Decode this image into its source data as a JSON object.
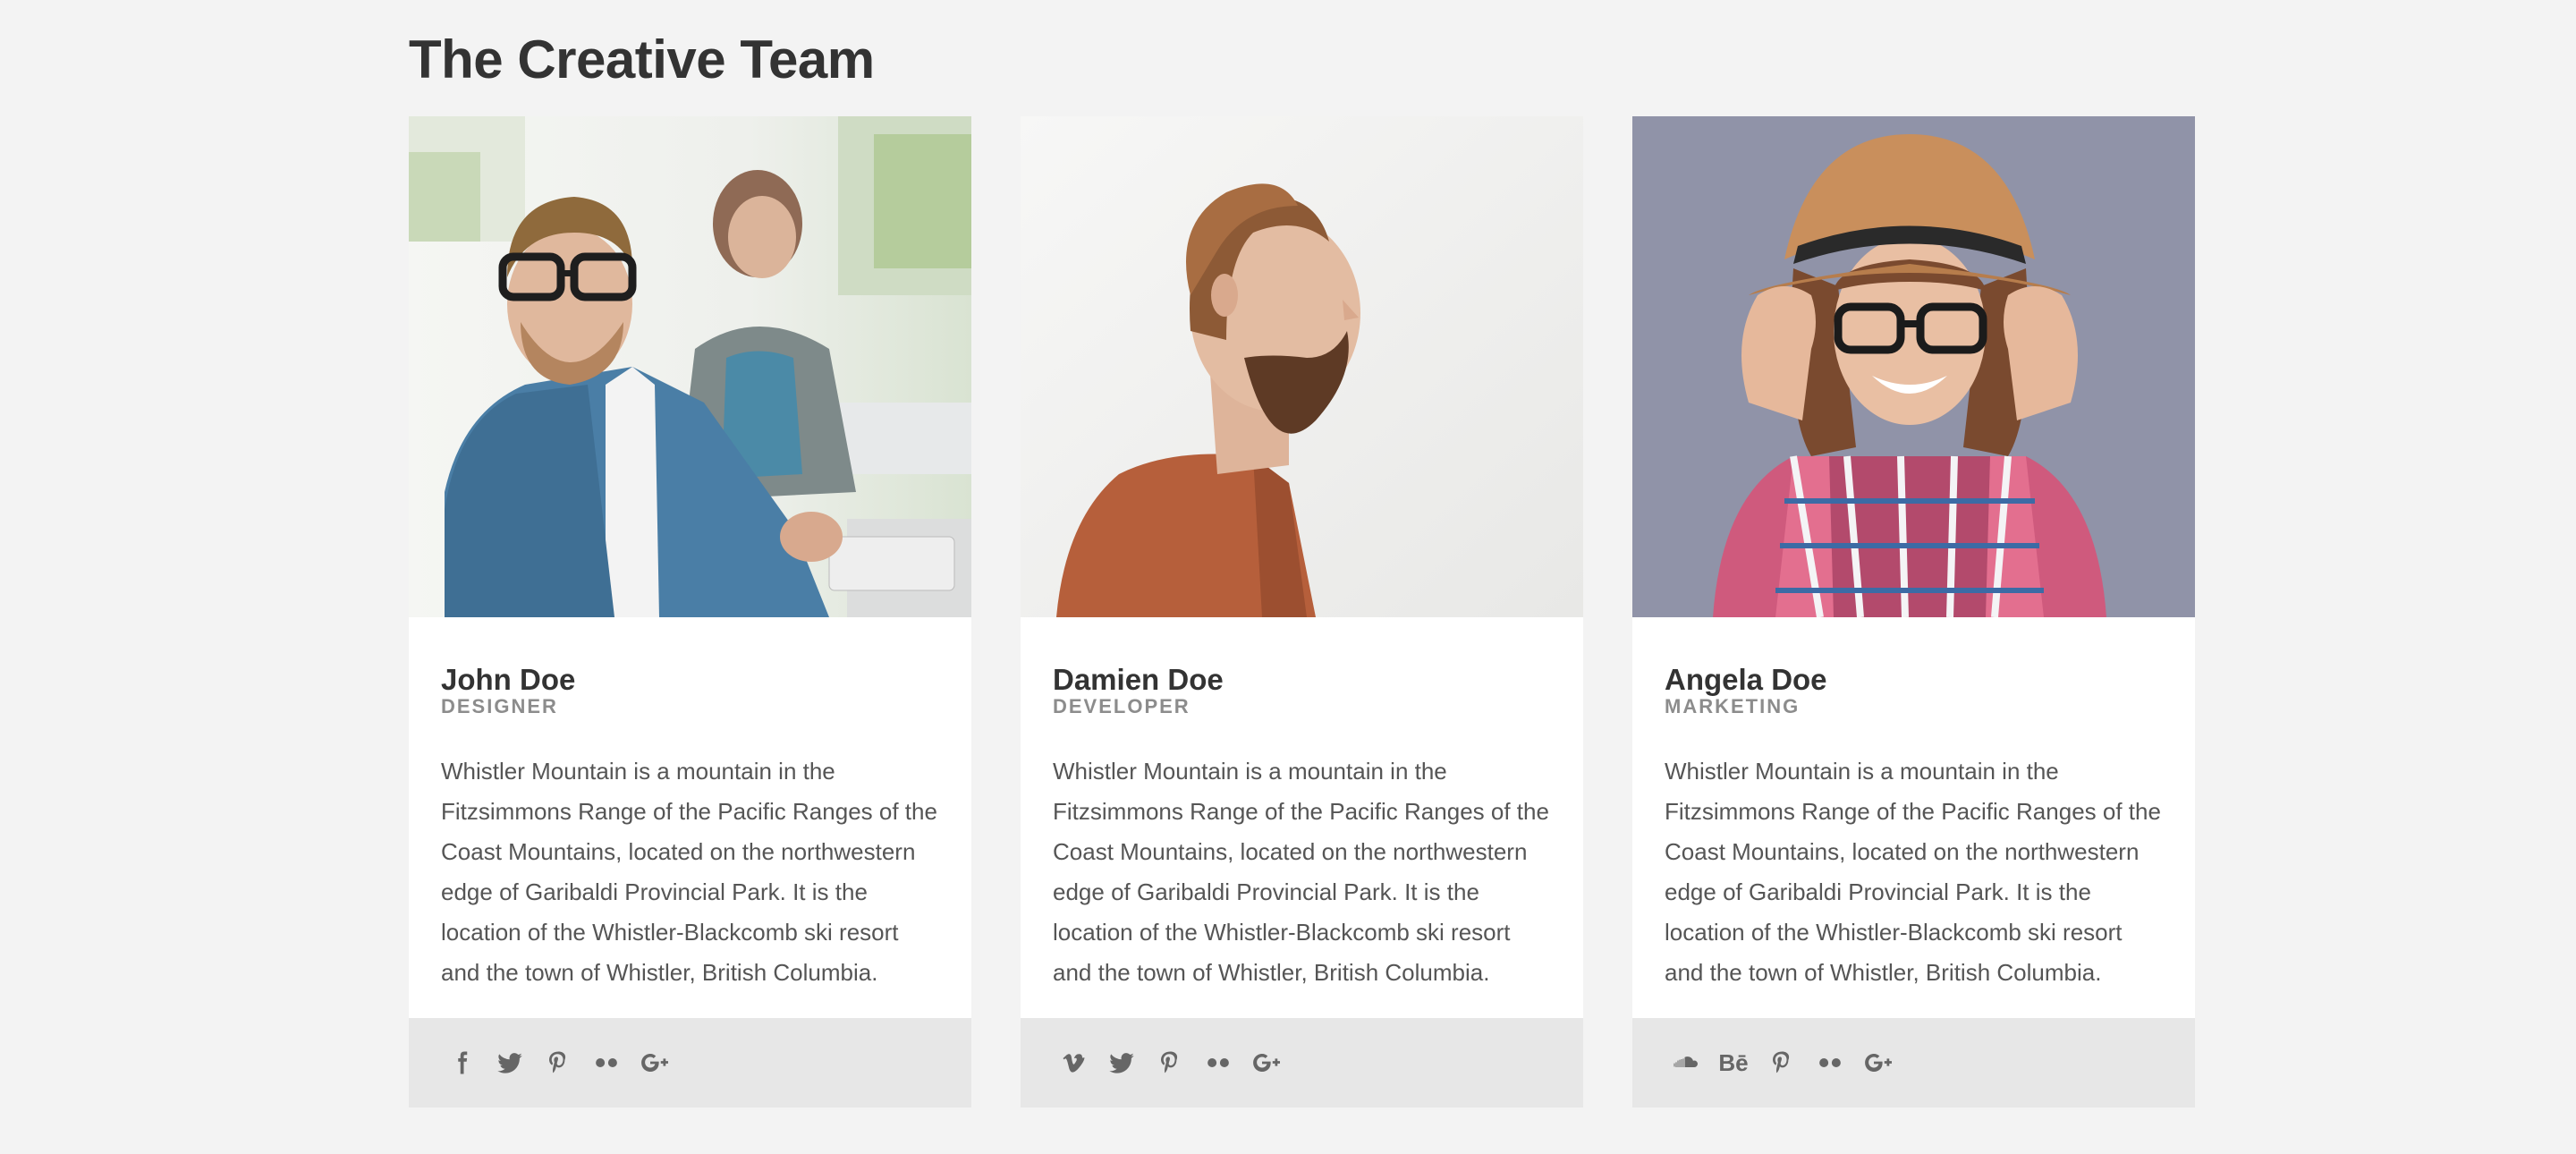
{
  "page": {
    "title": "The Creative Team",
    "background": "#f3f3f3"
  },
  "team": [
    {
      "name": "John Doe",
      "role": "DESIGNER",
      "bio": "Whistler Mountain is a mountain in the Fitzsimmons Range of the Pacific Ranges of the Coast Mountains, located on the northwestern edge of Garibaldi Provincial Park. It is the location of the Whistler-Blackcomb ski resort and the town of Whistler, British Columbia.",
      "photo_icon": "photo-man-glasses-office",
      "social": [
        "facebook-icon",
        "twitter-icon",
        "pinterest-icon",
        "flickr-icon",
        "google-plus-icon"
      ]
    },
    {
      "name": "Damien Doe",
      "role": "DEVELOPER",
      "bio": "Whistler Mountain is a mountain in the Fitzsimmons Range of the Pacific Ranges of the Coast Mountains, located on the northwestern edge of Garibaldi Provincial Park. It is the location of the Whistler-Blackcomb ski resort and the town of Whistler, British Columbia.",
      "photo_icon": "photo-man-beard-profile",
      "social": [
        "vimeo-icon",
        "twitter-icon",
        "pinterest-icon",
        "flickr-icon",
        "google-plus-icon"
      ]
    },
    {
      "name": "Angela Doe",
      "role": "MARKETING",
      "bio": "Whistler Mountain is a mountain in the Fitzsimmons Range of the Pacific Ranges of the Coast Mountains, located on the northwestern edge of Garibaldi Provincial Park. It is the location of the Whistler-Blackcomb ski resort and the town of Whistler, British Columbia.",
      "photo_icon": "photo-woman-hat-glasses",
      "social": [
        "soundcloud-icon",
        "behance-icon",
        "pinterest-icon",
        "flickr-icon",
        "google-plus-icon"
      ]
    }
  ],
  "colors": {
    "card_background": "#ffffff",
    "footer_background": "#e7e7e7",
    "icon_color": "#666666",
    "role_color": "#8c8c8c",
    "title_color": "#333333"
  }
}
